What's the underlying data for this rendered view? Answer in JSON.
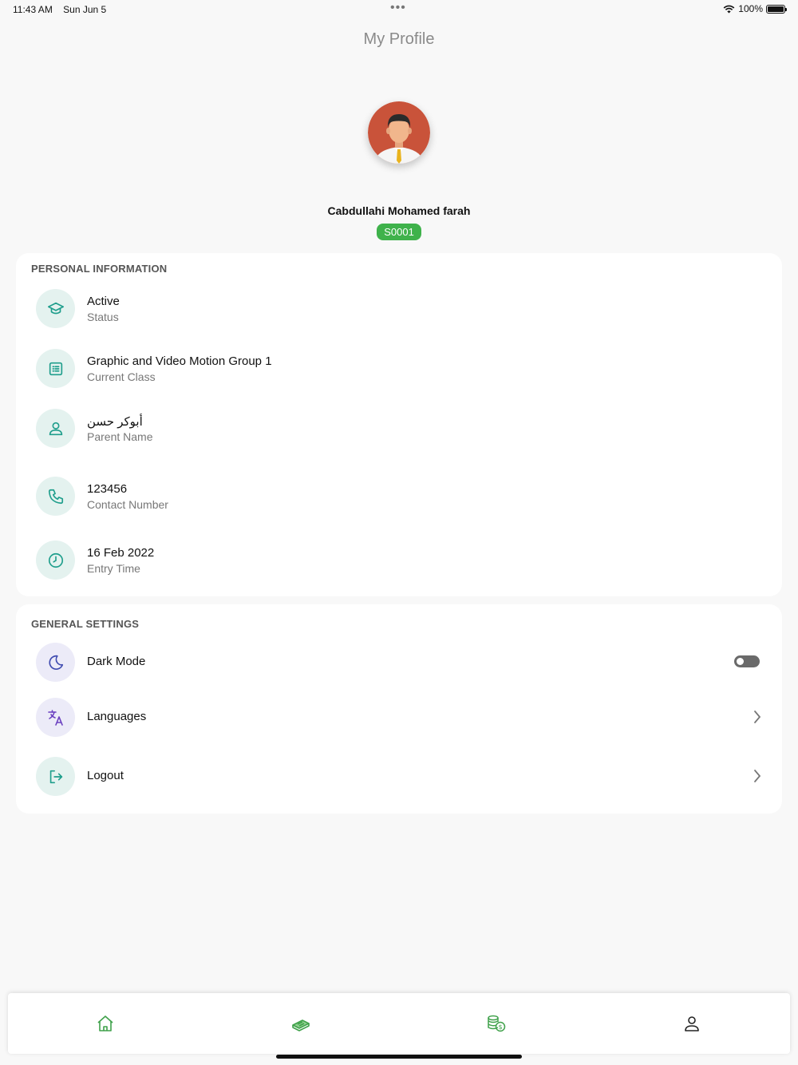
{
  "status_bar": {
    "time": "11:43 AM",
    "date": "Sun Jun 5",
    "battery": "100%"
  },
  "header": {
    "title": "My Profile"
  },
  "profile": {
    "name": "Cabdullahi Mohamed farah",
    "student_id": "S0001"
  },
  "personal_information": {
    "title": "PERSONAL INFORMATION",
    "items": [
      {
        "value": "Active",
        "label": "Status",
        "icon": "graduation-cap-icon"
      },
      {
        "value": "Graphic and Video Motion Group 1",
        "label": "Current Class",
        "icon": "class-list-icon"
      },
      {
        "value": "أبوكر حسن",
        "label": "Parent Name",
        "icon": "user-icon"
      },
      {
        "value": "123456",
        "label": "Contact Number",
        "icon": "phone-icon"
      },
      {
        "value": "16 Feb 2022",
        "label": "Entry Time",
        "icon": "clock-icon"
      }
    ]
  },
  "general_settings": {
    "title": "GENERAL SETTINGS",
    "items": [
      {
        "label": "Dark Mode",
        "icon": "moon-icon",
        "control": "toggle",
        "enabled": false
      },
      {
        "label": "Languages",
        "icon": "translate-icon",
        "control": "chevron"
      },
      {
        "label": "Logout",
        "icon": "logout-icon",
        "control": "chevron"
      }
    ]
  },
  "tab_bar": {
    "items": [
      "home-icon",
      "book-icon",
      "coins-icon",
      "profile-icon"
    ],
    "active_index": 3
  },
  "colors": {
    "accent": "#3fb24b",
    "icon_teal": "#1f9e8c",
    "icon_purple": "#6a3fc0",
    "icon_bg": "#e4f2ef"
  }
}
